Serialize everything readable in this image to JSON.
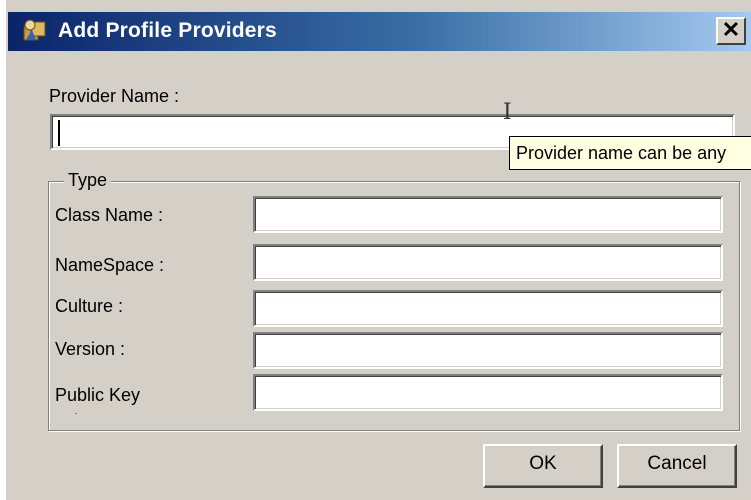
{
  "window": {
    "title": "Add Profile Providers",
    "close_label": "✕"
  },
  "provider_name": {
    "label": "Provider Name :",
    "value": ""
  },
  "tooltip": {
    "text": "Provider name can be any"
  },
  "type_group": {
    "legend": "Type",
    "fields": [
      {
        "label": "Class Name :",
        "value": ""
      },
      {
        "label": "NameSpace :",
        "value": ""
      },
      {
        "label": "Culture :",
        "value": ""
      },
      {
        "label": "Version :",
        "value": ""
      },
      {
        "label": "Public Key Token :",
        "value": ""
      }
    ]
  },
  "buttons": {
    "ok": "OK",
    "cancel": "Cancel"
  }
}
